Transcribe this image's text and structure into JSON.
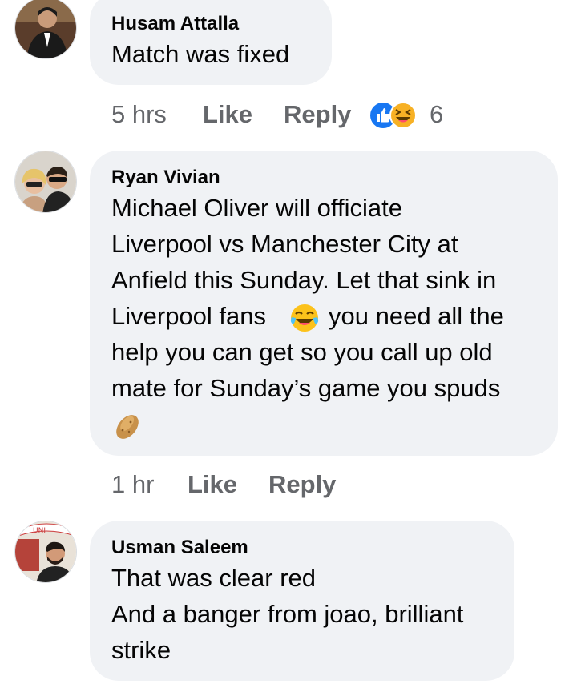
{
  "comments": [
    {
      "author": "Husam Attalla",
      "lines": [
        "Match was fixed"
      ],
      "time": "5 hrs",
      "like_label": "Like",
      "reply_label": "Reply",
      "reaction_count": "6",
      "reaction_icons": [
        "like-reaction-icon",
        "haha-reaction-icon"
      ]
    },
    {
      "author": "Ryan Vivian",
      "lines": [
        "Michael Oliver will officiate",
        "Liverpool vs Manchester City at",
        "Anfield this Sunday. Let that sink in",
        "Liverpool fans",
        "you need all the",
        "help you can get so you call up old",
        "mate for Sunday’s game you spuds"
      ],
      "emojis": [
        "tears-of-joy-emoji",
        "potato-emoji"
      ],
      "time": "1 hr",
      "like_label": "Like",
      "reply_label": "Reply"
    },
    {
      "author": "Usman Saleem",
      "lines": [
        "That was clear red",
        "And a banger from joao, brilliant",
        "strike"
      ],
      "avatar_sign_text": "UNI"
    }
  ],
  "colors": {
    "bubble": "#f0f2f5",
    "meta_text": "#65676b",
    "like_blue": "#1877f2",
    "haha_yellow": "#f7b125"
  }
}
